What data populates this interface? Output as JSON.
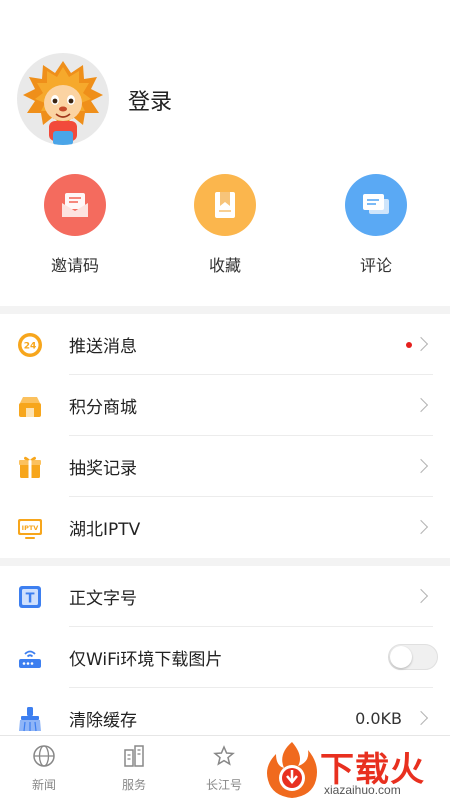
{
  "profile": {
    "login_label": "登录"
  },
  "quick_actions": [
    {
      "label": "邀请码",
      "icon": "invite-icon",
      "color": "#f46b5e"
    },
    {
      "label": "收藏",
      "icon": "bookmark-icon",
      "color": "#fbb64d"
    },
    {
      "label": "评论",
      "icon": "comment-icon",
      "color": "#5aa9f4"
    }
  ],
  "menu_group_1": [
    {
      "label": "推送消息",
      "icon": "push-24-icon",
      "has_dot": true
    },
    {
      "label": "积分商城",
      "icon": "shop-icon"
    },
    {
      "label": "抽奖记录",
      "icon": "gift-icon"
    },
    {
      "label": "湖北IPTV",
      "icon": "iptv-icon",
      "icon_text": "IPTV"
    }
  ],
  "menu_group_2": [
    {
      "label": "正文字号",
      "icon": "font-size-icon",
      "icon_text": "T"
    },
    {
      "label": "仅WiFi环境下载图片",
      "icon": "router-icon",
      "toggle_on": false
    },
    {
      "label": "清除缓存",
      "icon": "broom-icon",
      "value": "0.0KB"
    }
  ],
  "push_badge_text": "24",
  "tabbar": [
    {
      "label": "新闻",
      "icon": "globe-icon"
    },
    {
      "label": "服务",
      "icon": "building-icon"
    },
    {
      "label": "长江号",
      "icon": "star-icon"
    }
  ],
  "watermark": {
    "text": "下载火",
    "url": "xiazaihuo.com"
  },
  "colors": {
    "accent_red": "#e5201d",
    "icon_orange": "#f7a61c",
    "icon_blue": "#3d7ff0"
  }
}
